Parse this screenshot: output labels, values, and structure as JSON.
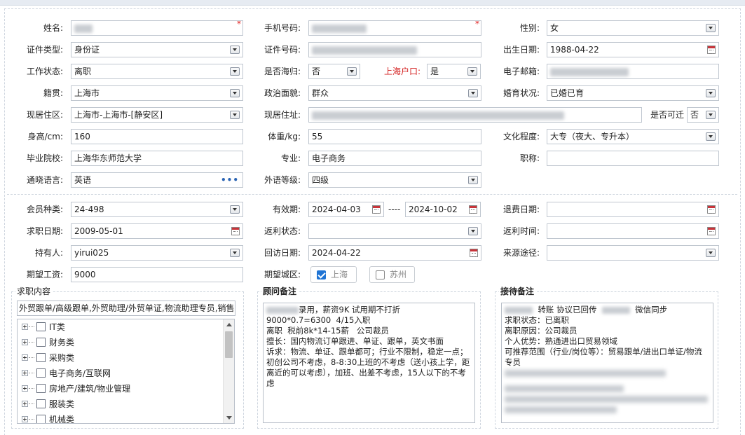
{
  "form": {
    "name": {
      "label": "姓名:",
      "required": "*"
    },
    "phone": {
      "label": "手机号码:",
      "required": "*"
    },
    "gender": {
      "label": "性别:",
      "value": "女"
    },
    "id_type": {
      "label": "证件类型:",
      "value": "身份证"
    },
    "id_number": {
      "label": "证件号码:"
    },
    "birth_date": {
      "label": "出生日期:",
      "value": "1988-04-22"
    },
    "work_status": {
      "label": "工作状态:",
      "value": "离职"
    },
    "returnee": {
      "label": "是否海归:",
      "value": "否"
    },
    "shanghai_hukou": {
      "label": "上海户口:",
      "value": "是"
    },
    "email": {
      "label": "电子邮箱:"
    },
    "native_place": {
      "label": "籍贯:",
      "value": "上海市"
    },
    "political_status": {
      "label": "政治面貌:",
      "value": "群众"
    },
    "marital_status": {
      "label": "婚育状况:",
      "value": "已婚已育"
    },
    "residence_area": {
      "label": "现居住区:",
      "value": "上海市-上海市-[静安区]"
    },
    "residence_address": {
      "label": "现居住址:"
    },
    "transferable": {
      "label": "是否可迁",
      "value": "否"
    },
    "height": {
      "label": "身高/cm:",
      "value": "160"
    },
    "weight": {
      "label": "体重/kg:",
      "value": "55"
    },
    "education": {
      "label": "文化程度:",
      "value": "大专（夜大、专升本）"
    },
    "school": {
      "label": "毕业院校:",
      "value": "上海华东师范大学"
    },
    "major": {
      "label": "专业:",
      "value": "电子商务"
    },
    "title": {
      "label": "职称:",
      "value": ""
    },
    "language": {
      "label": "通晓语言:",
      "value": "英语",
      "more": "•••"
    },
    "language_level": {
      "label": "外语等级:",
      "value": "四级"
    },
    "member_type": {
      "label": "会员种类:",
      "value": "24-498"
    },
    "valid_period": {
      "label": "有效期:",
      "start": "2024-04-03",
      "sep": "----",
      "end": "2024-10-02"
    },
    "refund_date": {
      "label": "退费日期:",
      "value": ""
    },
    "job_date": {
      "label": "求职日期:",
      "value": "2009-05-01"
    },
    "rebate_status": {
      "label": "返利状态:",
      "value": ""
    },
    "rebate_time": {
      "label": "返利时间:",
      "value": ""
    },
    "holder": {
      "label": "持有人:",
      "value": "yirui025"
    },
    "visit_date": {
      "label": "回访日期:",
      "value": "2024-04-22"
    },
    "source": {
      "label": "来源途径:",
      "value": ""
    },
    "salary": {
      "label": "期望工资:",
      "value": "9000"
    },
    "city": {
      "label": "期望城区:",
      "options": [
        {
          "label": "上海",
          "checked": true
        },
        {
          "label": "苏州",
          "checked": false
        }
      ]
    }
  },
  "job_content": {
    "legend": "求职内容",
    "summary": "外贸跟单/高级跟单,外贸助理/外贸单证,物流助理专员,销售",
    "tree": [
      "IT类",
      "财务类",
      "采购类",
      "电子商务/互联网",
      "房地产/建筑/物业管理",
      "服装类",
      "机械类"
    ]
  },
  "consultant_note": {
    "legend": "顾问备注",
    "lines": [
      "录用，薪资9K 试用期不打折",
      "9000*0.7=6300  4/15入职",
      "",
      "离职  税前8k*14-15薪   公司裁员",
      "擅长：国内物流订单跟进、单证、跟单，英文书面",
      "诉求：物流、单证、跟单都可；行业不限制，稳定一点；初创公司不考虑，8-8:30上班的不考虑（送小孩上学，距离近的可以考虑），加班、出差不考虑，15人以下的不考虑"
    ]
  },
  "reception_note": {
    "legend": "接待备注",
    "lines": [
      "转账 协议已回传",
      "微信同步",
      "求职状态：已离职",
      "离职原因：公司裁员",
      "个人优势：熟通进出口贸易领域",
      "可推荐范围（行业/岗位等）：贸易跟单/进出口单证/物流专员"
    ]
  },
  "colors": {
    "required": "#e02020",
    "hukou_label": "#d42020",
    "link_dots": "#2a64b4",
    "checkbox_on": "#1f74d4"
  }
}
